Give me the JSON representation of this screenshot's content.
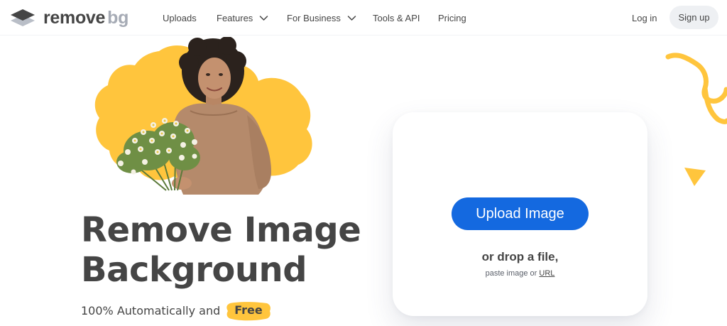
{
  "header": {
    "logo": {
      "remove": "remove",
      "bg": "bg"
    },
    "nav": {
      "uploads": "Uploads",
      "features": "Features",
      "for_business": "For Business",
      "tools_api": "Tools & API",
      "pricing": "Pricing"
    },
    "login": "Log in",
    "signup": "Sign up"
  },
  "hero": {
    "headline_line1": "Remove Image",
    "headline_line2": "Background",
    "subline_prefix": "100% Automatically and",
    "subline_highlight": "Free"
  },
  "upload_card": {
    "button_label": "Upload Image",
    "drop_text": "or drop a file,",
    "paste_prefix": "paste image or",
    "url_label": "URL"
  },
  "colors": {
    "primary_blue": "#1469e0",
    "accent_yellow": "#ffc53d",
    "text_dark": "#454545",
    "logo_gray": "#a6abb5"
  },
  "icons": {
    "logo_mark": "layered-diamond-icon",
    "dropdown": "chevron-down-icon"
  }
}
